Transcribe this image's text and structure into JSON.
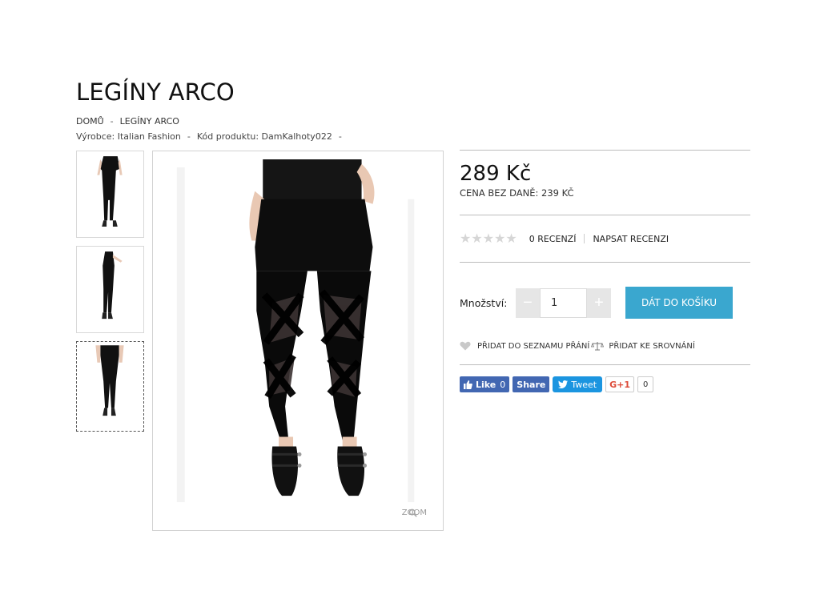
{
  "product": {
    "title": "LEGÍNY ARCO"
  },
  "breadcrumb": {
    "home": "DOMŮ",
    "separator": "-",
    "current": "LEGÍNY ARCO"
  },
  "meta": {
    "manufacturer": "Výrobce: Italian Fashion",
    "separator": "-",
    "code": "Kód produktu: DamKalhoty022",
    "trailing_separator": "-"
  },
  "gallery": {
    "zoom_label": "ZOOM",
    "selected_thumbnail": 3
  },
  "pricing": {
    "price": "289 Kč",
    "price_no_tax": "CENA BEZ DANĚ: 239 KČ"
  },
  "reviews": {
    "rating": 0,
    "max_rating": 5,
    "count_label": "0 RECENZÍ",
    "write_label": "NAPSAT RECENZI"
  },
  "purchase": {
    "qty_label": "Množství:",
    "qty_value": "1",
    "minus": "−",
    "plus": "+",
    "add_to_cart": "DÁT DO KOŠÍKU"
  },
  "actions": {
    "wishlist": "PŘIDAT DO SEZNAMU PŘÁNÍ",
    "compare": "PŘIDAT KE SROVNÁNÍ"
  },
  "social": {
    "like": "Like",
    "like_count": "0",
    "share": "Share",
    "tweet": "Tweet",
    "gplus": "G+1",
    "gplus_count": "0"
  },
  "colors": {
    "accent": "#3aa7cf",
    "facebook": "#4267b2",
    "twitter": "#1b95e0",
    "gplus": "#dd4b39"
  }
}
